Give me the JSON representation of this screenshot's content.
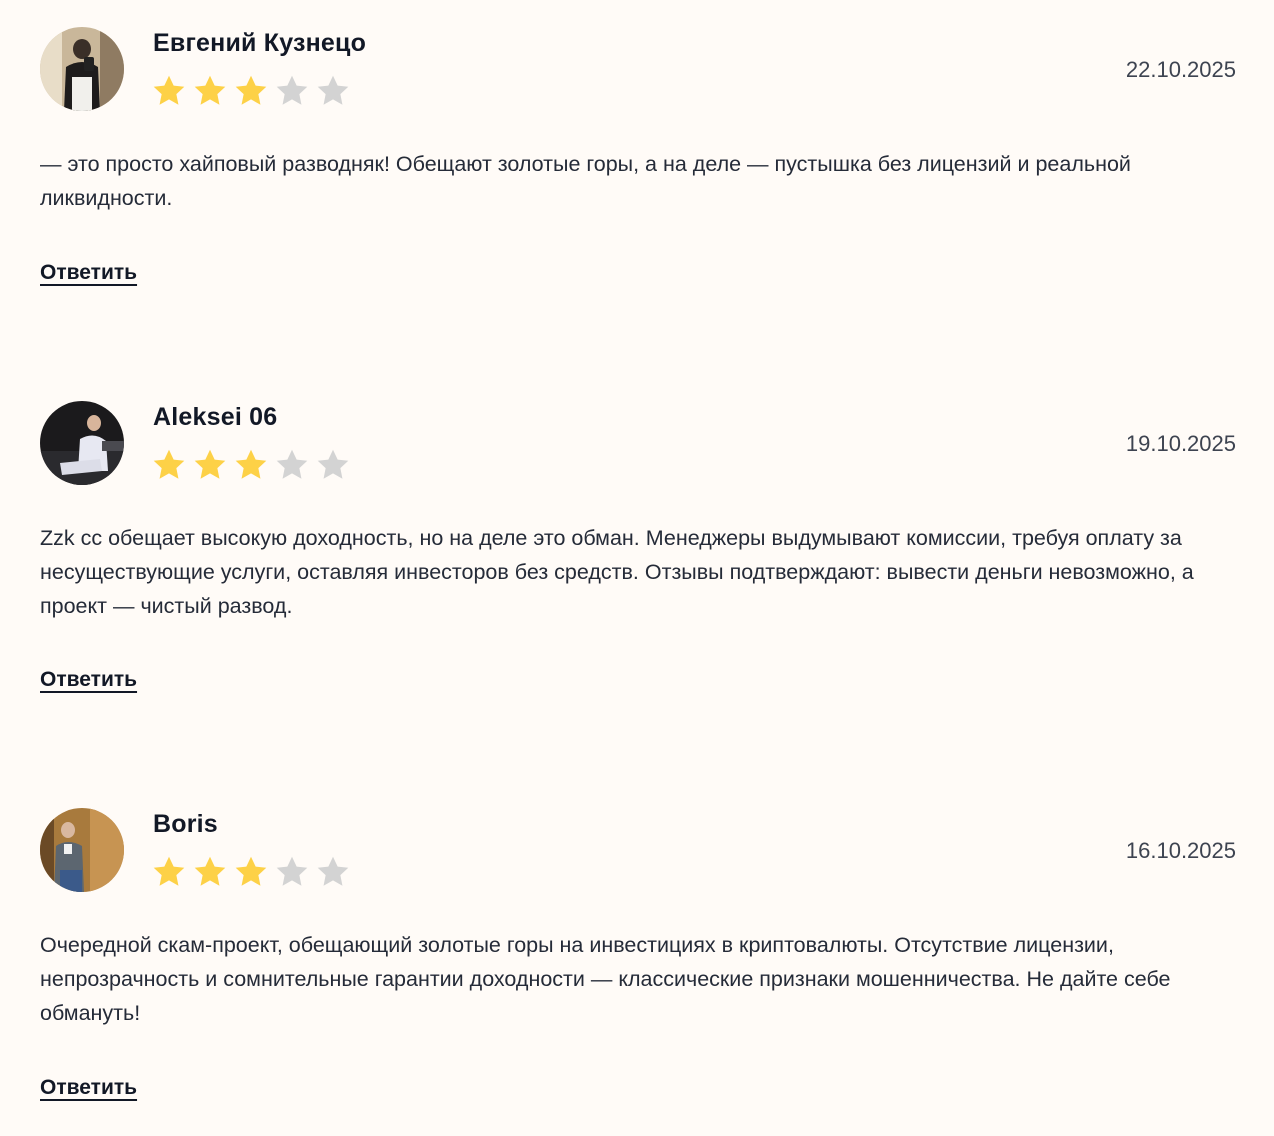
{
  "reply_label": "Ответить",
  "reviews": [
    {
      "author": "Евгений Кузнецо",
      "date": "22.10.2025",
      "rating": 3,
      "max_rating": 5,
      "text": "— это просто хайповый разводняк! Обещают золотые горы, а на деле — пустышка без лицензий и реальной ликвидности."
    },
    {
      "author": "Aleksei 06",
      "date": "19.10.2025",
      "rating": 3,
      "max_rating": 5,
      "text": "Zzk cc обещает высокую доходность, но на деле это обман. Менеджеры выдумывают комиссии, требуя оплату за несуществующие услуги, оставляя инвесторов без средств. Отзывы подтверждают: вывести деньги невозможно, а проект — чистый развод."
    },
    {
      "author": "Boris",
      "date": "16.10.2025",
      "rating": 3,
      "max_rating": 5,
      "text": "Очередной скам-проект, обещающий золотые горы на инвестициях в криптовалюты. Отсутствие лицензии, непрозрачность и сомнительные гарантии доходности — классические признаки мошенничества. Не дайте себе обмануть!"
    }
  ],
  "colors": {
    "background": "#fffbf7",
    "star_filled": "#fdd147",
    "star_empty": "#d3d3d3",
    "text": "#252b38",
    "heading": "#121826"
  }
}
